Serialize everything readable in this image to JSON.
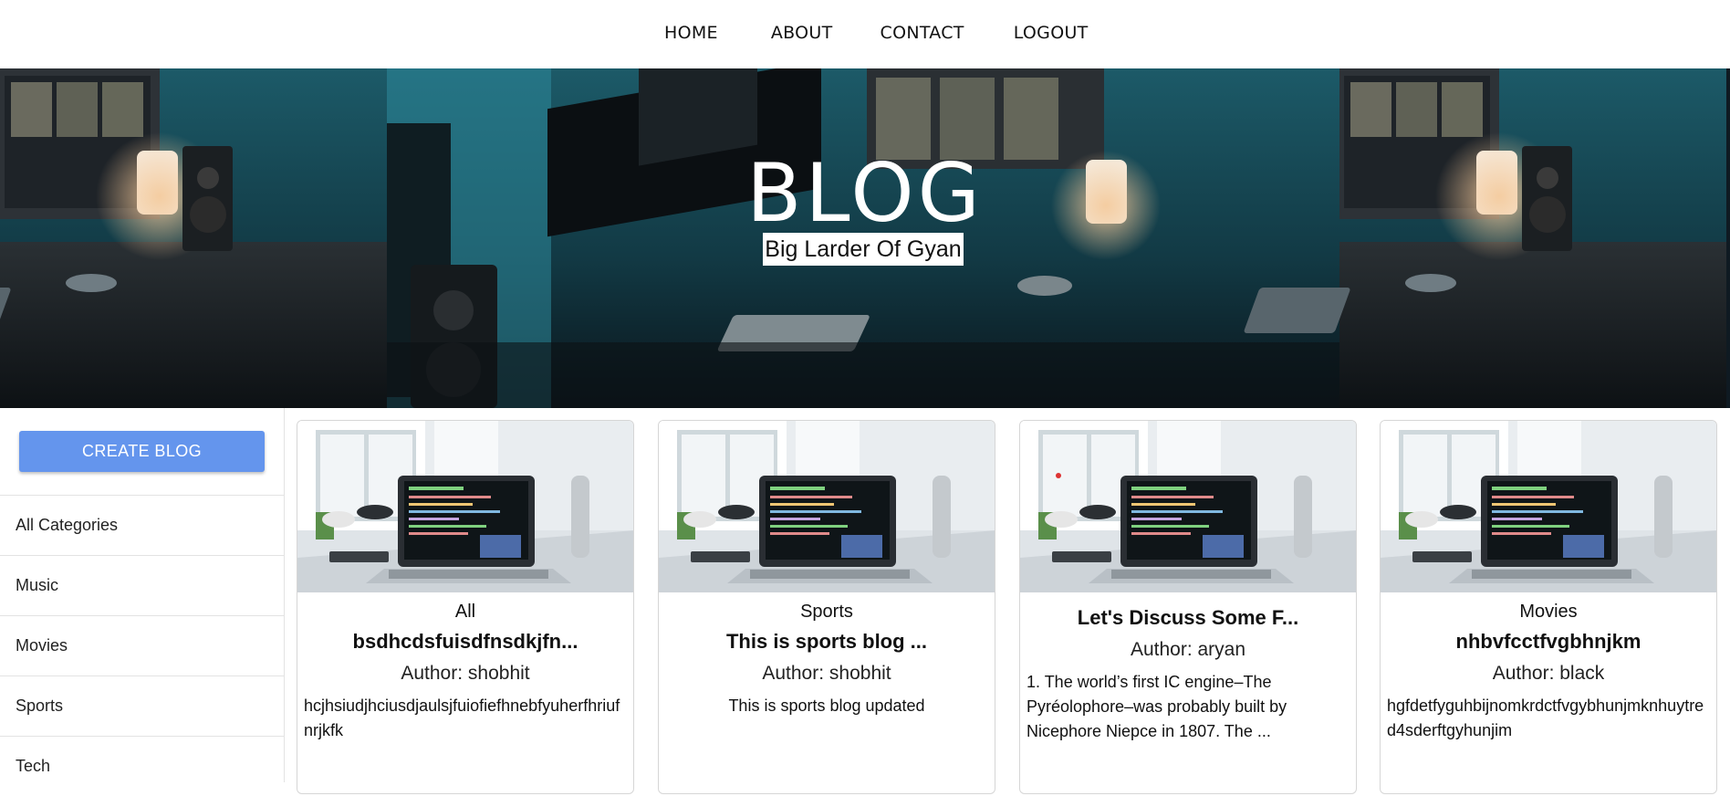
{
  "nav": {
    "items": [
      "HOME",
      "ABOUT",
      "CONTACT",
      "LOGOUT"
    ]
  },
  "hero": {
    "title": "BLOG",
    "subtitle": "Big Larder Of Gyan"
  },
  "sidebar": {
    "create_button": "CREATE BLOG",
    "categories": [
      "All Categories",
      "Music",
      "Movies",
      "Sports",
      "Tech"
    ]
  },
  "posts": [
    {
      "category": "All",
      "title": "bsdhcdsfuisdfnsdkjfn...",
      "author": "Author: shobhit",
      "description": "hcjhsiudjhciusdjaulsjfuiofiefhnebfyuherfhriufnrjkfk"
    },
    {
      "category": "Sports",
      "title": "This is sports blog ...",
      "author": "Author: shobhit",
      "description": "This is sports blog updated"
    },
    {
      "category": "",
      "title": "Let's Discuss Some F...",
      "author": "Author: aryan",
      "description": "1. The world’s first IC engine–The Pyréolophore–was probably built by Nicephore Niepce in 1807. The ..."
    },
    {
      "category": "Movies",
      "title": "nhbvfcctfvgbhnjkm",
      "author": "Author: black",
      "description": "hgfdetfyguhbijnomkrdctfvgybhunjmknhuytred4sderftgyhunjim"
    }
  ],
  "colors": {
    "accent": "#6495ed",
    "hero_bg": "#0f1a22"
  },
  "icons": {
    "thumbnail": "laptop-desk-photo",
    "hero": "desk-setup-photo"
  }
}
